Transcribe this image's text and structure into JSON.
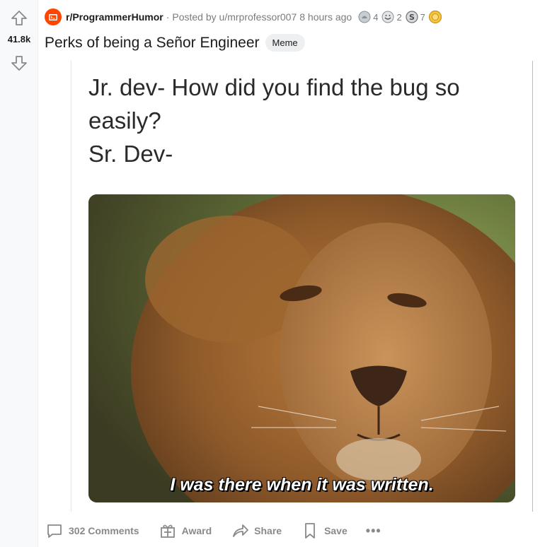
{
  "vote": {
    "score": "41.8k"
  },
  "post": {
    "subreddit": "r/ProgrammerHumor",
    "separator": "·",
    "posted_by_prefix": "Posted by",
    "author": "u/mrprofessor007",
    "time": "8 hours ago",
    "awards": [
      {
        "icon": "silver-award-icon",
        "count": "4"
      },
      {
        "icon": "wholesome-award-icon",
        "count": "2"
      },
      {
        "icon": "coin-award-icon",
        "count": "7"
      },
      {
        "icon": "gold-award-icon",
        "count": ""
      }
    ],
    "title": "Perks of being a Señor Engineer",
    "flair": "Meme"
  },
  "meme": {
    "line1": "Jr. dev- How did you find the bug so",
    "line2": "easily?",
    "line3": "Sr. Dev-",
    "subtitle": "I was there when it was written."
  },
  "actions": {
    "comments": "302 Comments",
    "award": "Award",
    "share": "Share",
    "save": "Save",
    "more": "•••"
  },
  "colors": {
    "subreddit_icon": "#ff4500",
    "meta_text": "#787c7e",
    "action_text": "#878a8c"
  }
}
